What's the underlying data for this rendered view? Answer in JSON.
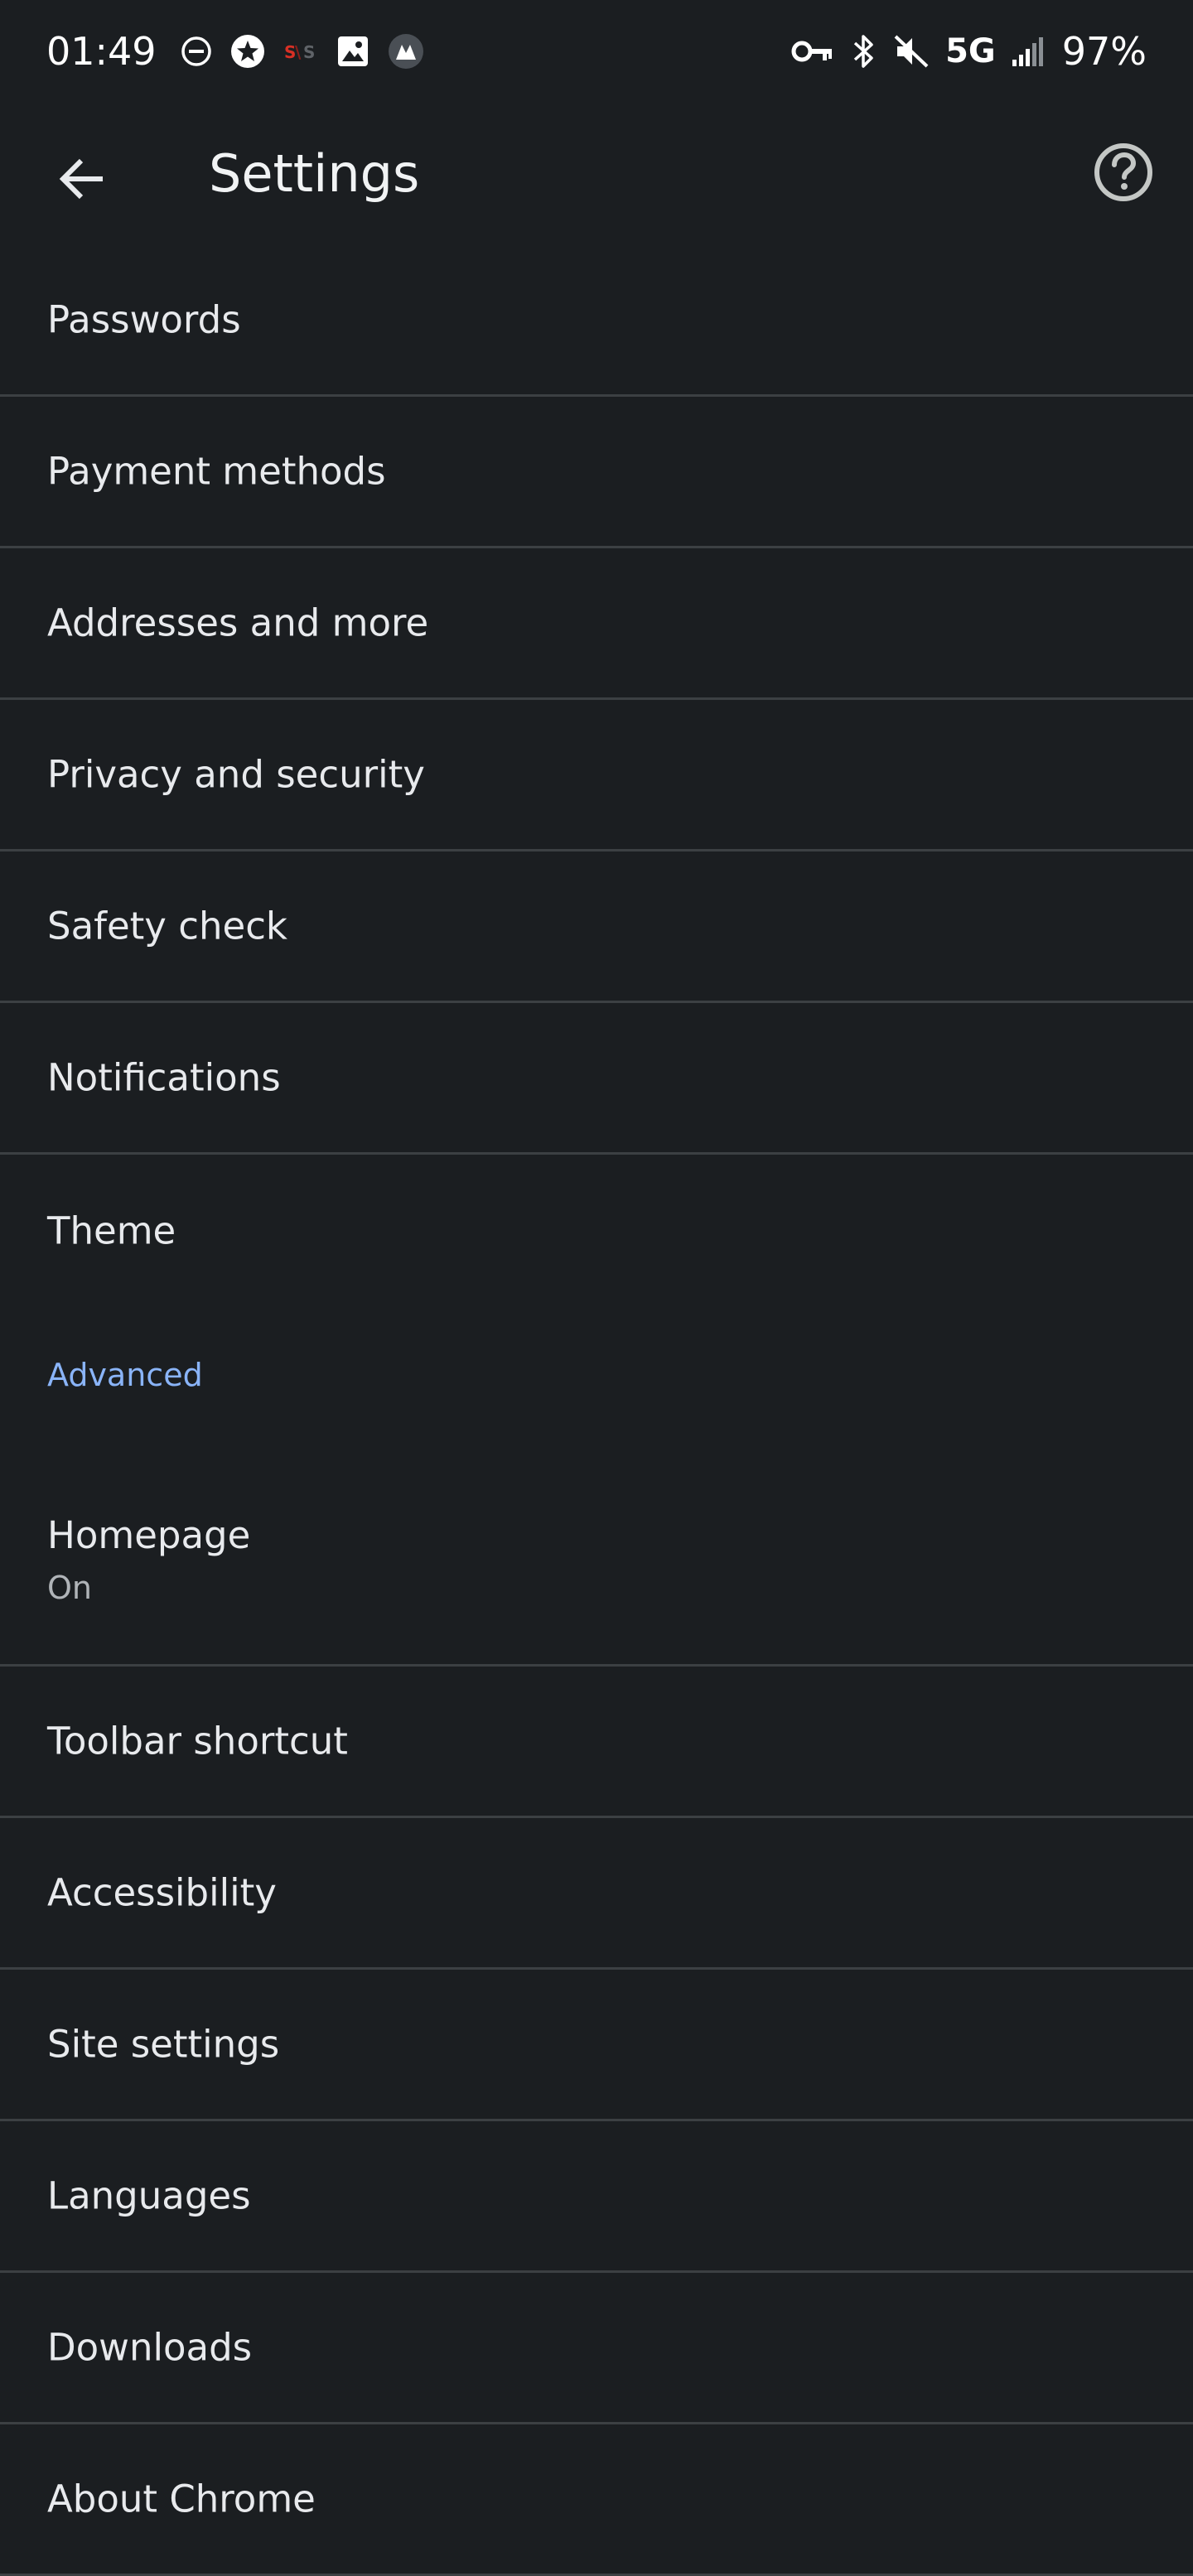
{
  "status_bar": {
    "time": "01:49",
    "left_icons": [
      "do-not-disturb-icon",
      "star-badge-icon",
      "sns-app-icon",
      "gallery-icon",
      "vpn-app-icon"
    ],
    "right_icons": [
      "vpn-key-icon",
      "bluetooth-icon",
      "mute-icon"
    ],
    "network": "5G",
    "battery": "97%"
  },
  "app_bar": {
    "title": "Settings",
    "back_icon": "arrow-back-icon",
    "help_icon": "help-circle-icon"
  },
  "settings": {
    "items": [
      {
        "label": "Passwords"
      },
      {
        "label": "Payment methods"
      },
      {
        "label": "Addresses and more"
      },
      {
        "label": "Privacy and security"
      },
      {
        "label": "Safety check"
      },
      {
        "label": "Notifications"
      },
      {
        "label": "Theme"
      }
    ],
    "advanced_header": "Advanced",
    "homepage": {
      "label": "Homepage",
      "summary": "On"
    },
    "advanced_items": [
      {
        "label": "Toolbar shortcut"
      },
      {
        "label": "Accessibility"
      },
      {
        "label": "Site settings"
      },
      {
        "label": "Languages"
      },
      {
        "label": "Downloads"
      },
      {
        "label": "About Chrome"
      }
    ]
  },
  "colors": {
    "background": "#1b1e21",
    "text": "#e8eaed",
    "accent": "#8ab4f8",
    "divider": "#3c4043"
  }
}
